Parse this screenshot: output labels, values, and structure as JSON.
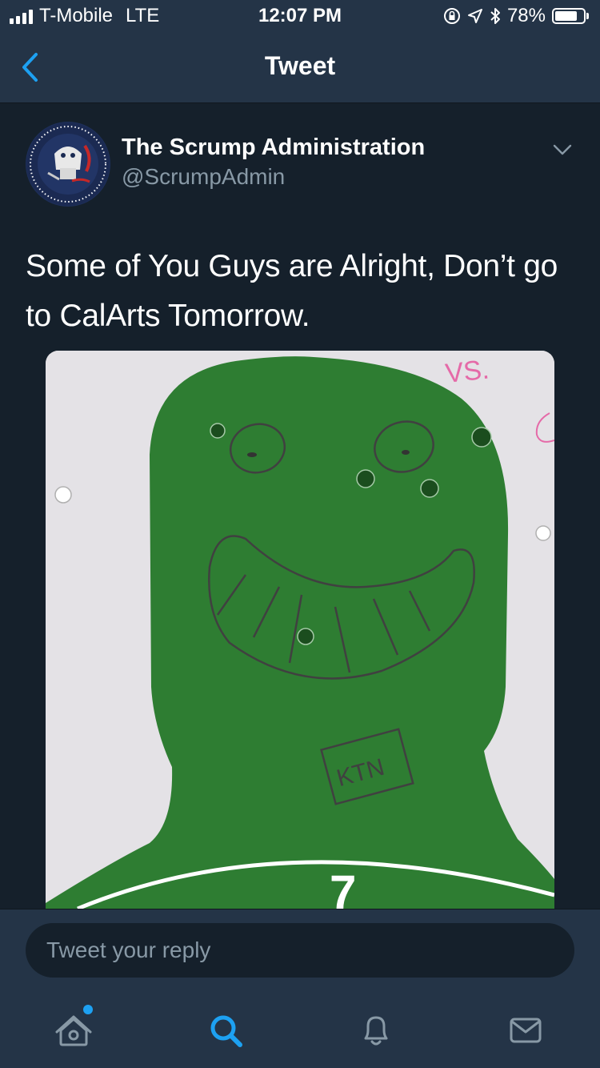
{
  "status_bar": {
    "carrier": "T-Mobile",
    "network": "LTE",
    "time": "12:07 PM",
    "battery_percent": "78%",
    "battery_level": 0.78,
    "icons": [
      "signal-icon",
      "orientation-lock-icon",
      "location-icon",
      "bluetooth-icon",
      "battery-icon"
    ]
  },
  "nav": {
    "title": "Tweet",
    "back_icon": "chevron-left-icon"
  },
  "tweet": {
    "author_name": "The Scrump Administration",
    "author_handle": "@ScrumpAdmin",
    "text": "Some of You Guys are Alright, Don’t go to CalArts Tomorrow.",
    "media": {
      "annotation": "VS.",
      "target_mark": "7",
      "logo_text": "KTN"
    }
  },
  "reply": {
    "placeholder": "Tweet your reply"
  },
  "tabs": [
    {
      "icon": "home-icon",
      "active": false,
      "has_notification_dot": true
    },
    {
      "icon": "search-icon",
      "active": true
    },
    {
      "icon": "notifications-icon",
      "active": false
    },
    {
      "icon": "messages-icon",
      "active": false
    }
  ],
  "colors": {
    "background": "#15202b",
    "bar": "#243447",
    "accent": "#1da1f2",
    "secondary_text": "#8899a6",
    "target_green": "#2e7d32"
  }
}
